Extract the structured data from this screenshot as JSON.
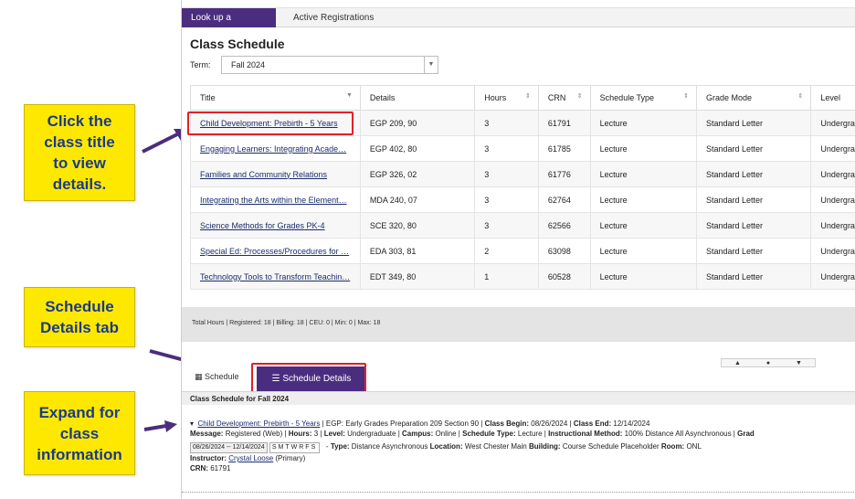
{
  "callouts": {
    "click_title": "Click the\nclass title\nto view\ndetails.",
    "schedule_details": "Schedule\nDetails tab",
    "expand": "Expand for\nclass\ninformation"
  },
  "tabs": {
    "lookup": "Look up a Schedule",
    "active": "Active Registrations"
  },
  "page_title": "Class Schedule",
  "term": {
    "label": "Term:",
    "value": "Fall 2024"
  },
  "table": {
    "headers": [
      "Title",
      "Details",
      "Hours",
      "CRN",
      "Schedule Type",
      "Grade Mode",
      "Level"
    ],
    "rows": [
      [
        "Child Development: Prebirth - 5 Years",
        "EGP 209, 90",
        "3",
        "61791",
        "Lecture",
        "Standard Letter",
        "Undergra"
      ],
      [
        "Engaging Learners: Integrating Acade…",
        "EGP 402, 80",
        "3",
        "61785",
        "Lecture",
        "Standard Letter",
        "Undergra"
      ],
      [
        "Families and Community Relations",
        "EGP 326, 02",
        "3",
        "61776",
        "Lecture",
        "Standard Letter",
        "Undergra"
      ],
      [
        "Integrating the Arts within the Element…",
        "MDA 240, 07",
        "3",
        "62764",
        "Lecture",
        "Standard Letter",
        "Undergra"
      ],
      [
        "Science Methods for Grades PK-4",
        "SCE 320, 80",
        "3",
        "62566",
        "Lecture",
        "Standard Letter",
        "Undergra"
      ],
      [
        "Special Ed: Processes/Procedures for …",
        "EDA 303, 81",
        "2",
        "63098",
        "Lecture",
        "Standard Letter",
        "Undergra"
      ],
      [
        "Technology Tools to Transform Teachin…",
        "EDT 349, 80",
        "1",
        "60528",
        "Lecture",
        "Standard Letter",
        "Undergra"
      ]
    ]
  },
  "totals": "Total Hours | Registered: 18 | Billing: 18 | CEU: 0 | Min: 0 | Max: 18",
  "bottom_tabs": {
    "schedule": "Schedule",
    "details": "Schedule Details"
  },
  "subheader": "Class Schedule for Fall 2024",
  "detail": {
    "course_link": "Child Development: Prebirth - 5 Years",
    "line1_rest": " | EGP: Early Grades Preparation 209 Section 90 | ",
    "class_begin_label": "Class Begin:",
    "class_begin": " 08/26/2024 | ",
    "class_end_label": "Class End:",
    "class_end": " 12/14/2024",
    "message_label": "Message:",
    "message": " Registered (Web) | ",
    "hours_label": "Hours:",
    "hours": " 3 | ",
    "level_label": "Level:",
    "level": " Undergraduate | ",
    "campus_label": "Campus:",
    "campus": " Online | ",
    "stype_label": "Schedule Type:",
    "stype": " Lecture | ",
    "imethod_label": "Instructional Method:",
    "imethod": " 100% Distance All Asynchronous | ",
    "grade_label": "Grad",
    "dates": "08/26/2024 -- 12/14/2024",
    "days": "SMTWRFS",
    "type_label": "Type:",
    "type": " Distance Asynchronous ",
    "location_label": "Location:",
    "location": " West Chester Main ",
    "building_label": "Building:",
    "building": " Course Schedule Placeholder ",
    "room_label": "Room:",
    "room": " ONL",
    "instructor_label": "Instructor:",
    "instructor": "Crystal Loose",
    "instructor_role": " (Primary)",
    "crn_label": "CRN:",
    "crn": " 61791"
  },
  "colors": {
    "accent": "#4b2d7f",
    "callout": "#ffe800",
    "highlight": "#e0202a"
  }
}
